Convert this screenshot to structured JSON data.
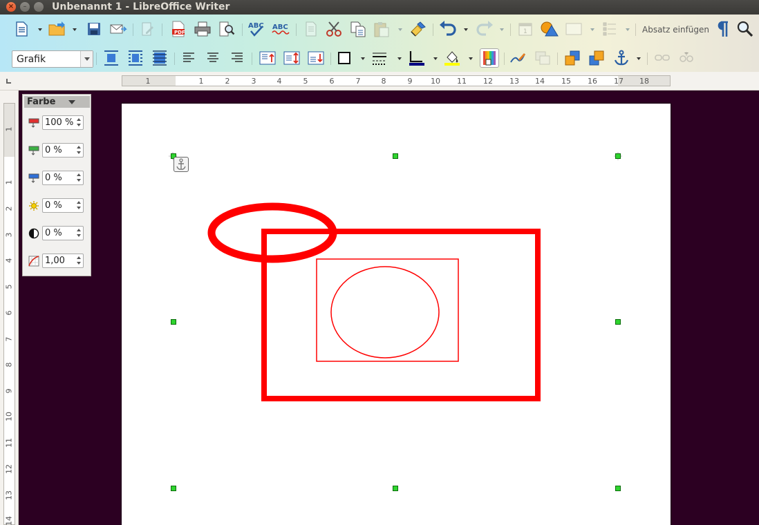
{
  "window": {
    "title": "Unbenannt 1 - LibreOffice Writer"
  },
  "toolbar": {
    "row1": {
      "absatz_label": "Absatz einfügen"
    },
    "row2": {
      "frame_style": "Grafik"
    }
  },
  "ruler": {
    "horizontal_labels": [
      "1",
      "1",
      "2",
      "3",
      "4",
      "5",
      "6",
      "7",
      "8",
      "9",
      "10",
      "11",
      "12",
      "13",
      "14",
      "15",
      "16",
      "17",
      "18"
    ],
    "vertical_labels": [
      "1",
      "1",
      "2",
      "3",
      "4",
      "5",
      "6",
      "7",
      "8",
      "9",
      "10",
      "11",
      "12",
      "13",
      "14"
    ]
  },
  "color_panel": {
    "title": "Farbe",
    "fields": [
      {
        "name": "red",
        "value": "100 %"
      },
      {
        "name": "green",
        "value": "0 %"
      },
      {
        "name": "blue",
        "value": "0 %"
      },
      {
        "name": "brightness",
        "value": "0 %"
      },
      {
        "name": "contrast",
        "value": "0 %"
      },
      {
        "name": "gamma",
        "value": "1,00"
      }
    ]
  },
  "colors": {
    "document_background": "#2c0022",
    "graphic_stroke": "#ff0000",
    "handle_fill": "#2fd42f"
  }
}
